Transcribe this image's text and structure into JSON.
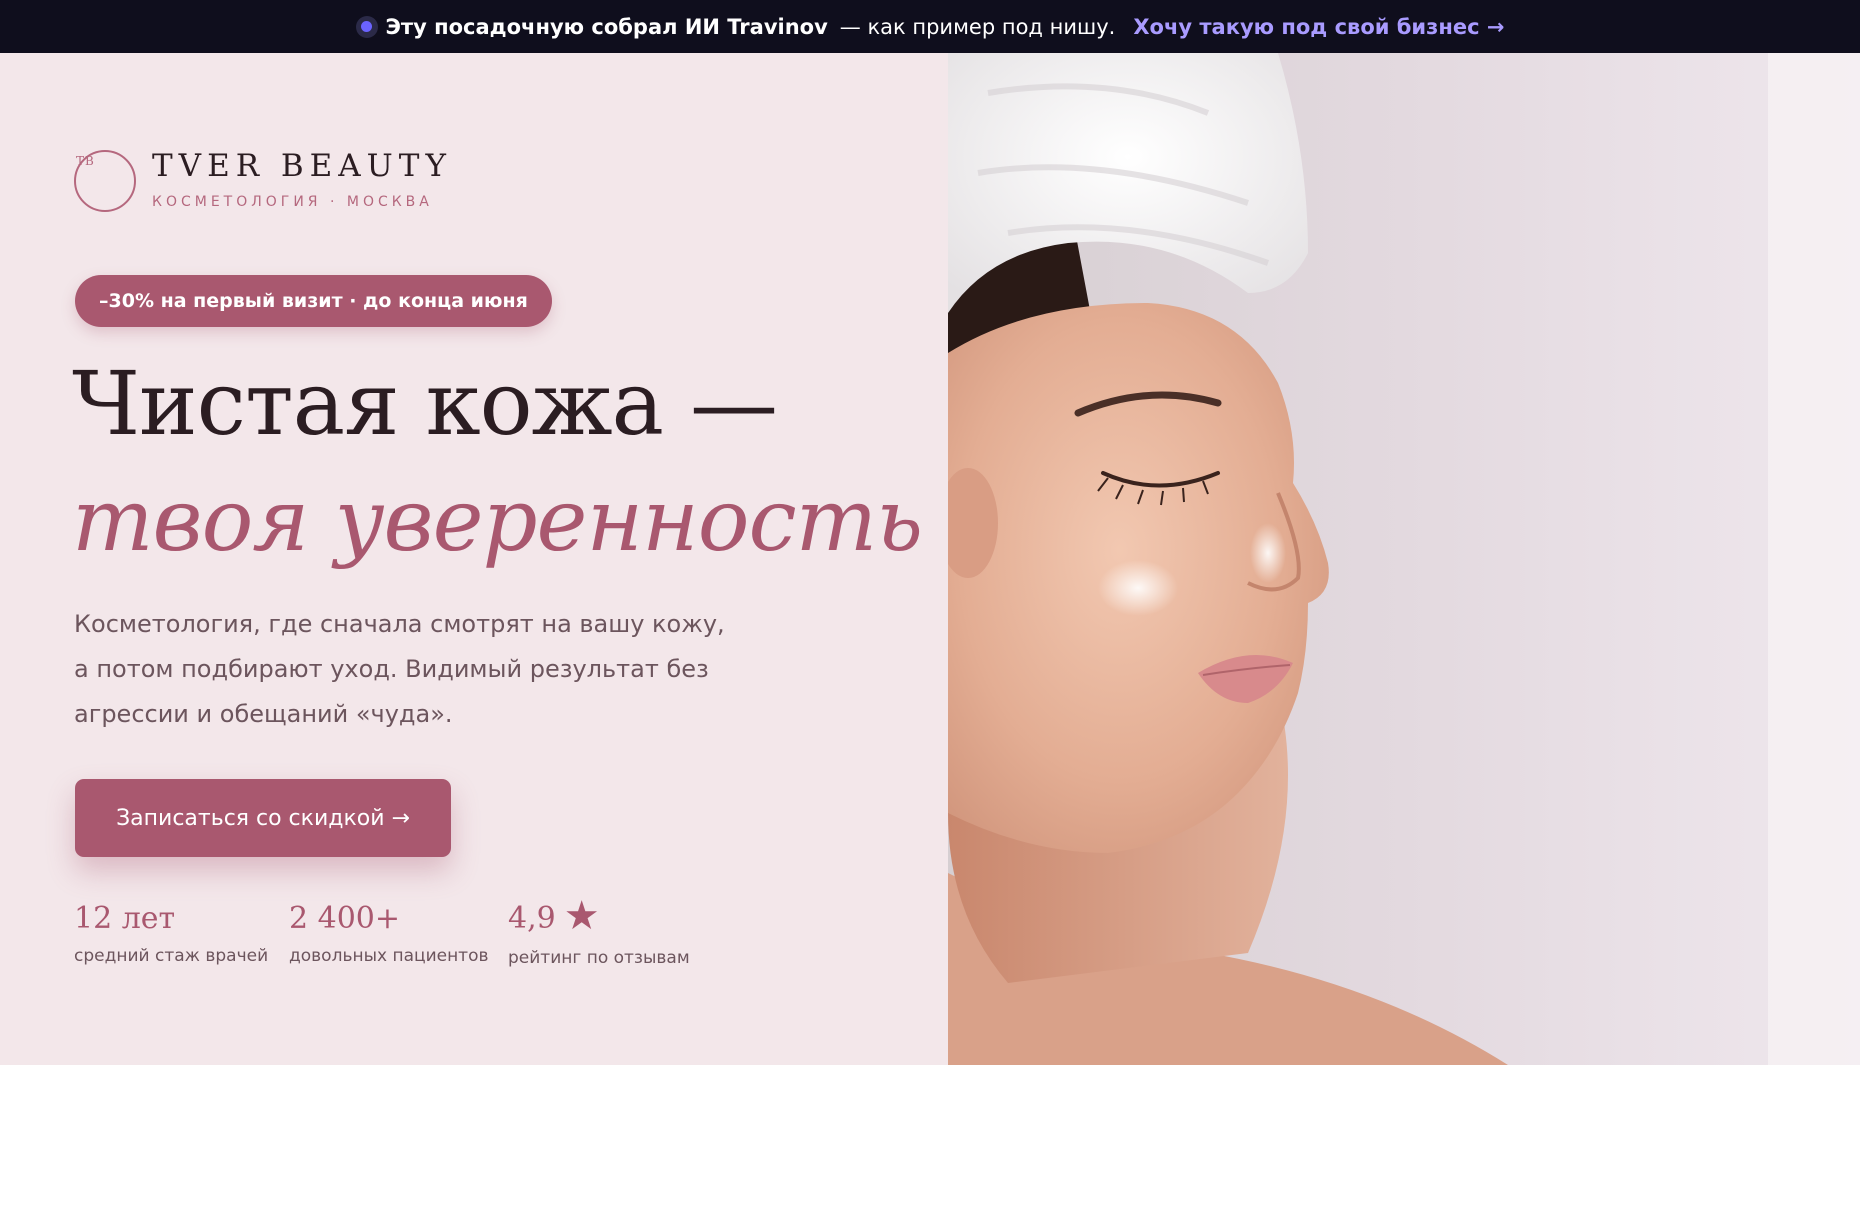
{
  "topbar": {
    "lead": "Эту посадочную собрал ИИ Travinov",
    "middle": "— как пример под нишу.",
    "cta": "Хочу такую под свой бизнес →"
  },
  "logo": {
    "monogram": "TB",
    "name": "TVER BEAUTY",
    "subtitle": "КОСМЕТОЛОГИЯ · МОСКВА"
  },
  "badge": "–30% на первый визит · до конца июня",
  "headline": {
    "line1": "Чистая кожа —",
    "line2": "твоя уверенность"
  },
  "description": "Косметология, где сначала смотрят на вашу кожу, а потом подбирают уход. Видимый результат без агрессии и обещаний «чуда».",
  "cta_button": "Записаться со скидкой →",
  "stats": [
    {
      "value": "12 лет",
      "label": "средний стаж врачей"
    },
    {
      "value": "2 400+",
      "label": "довольных пациентов"
    },
    {
      "value": "4,9",
      "label": "рейтинг по отзывам",
      "icon": "star-icon"
    }
  ],
  "hero_image": {
    "subject": "woman-with-towel-photo"
  },
  "colors": {
    "topbar_bg": "#0f0e1d",
    "topbar_accent": "#a99bff",
    "hero_bg": "#f3e7ea",
    "brand": "#a9586f",
    "heading": "#2b1d22",
    "body_text": "#6c555d"
  }
}
